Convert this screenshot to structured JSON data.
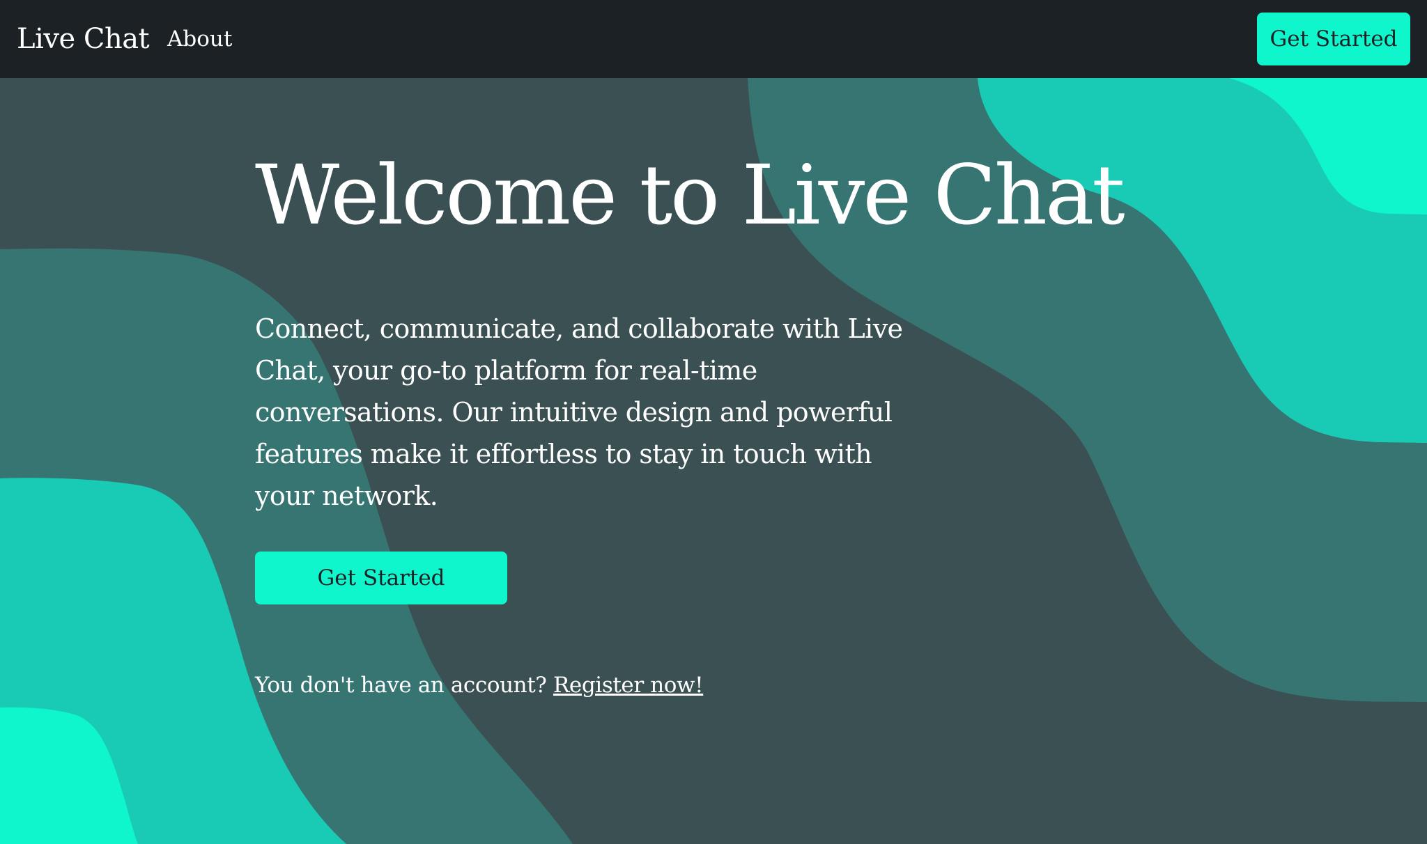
{
  "navbar": {
    "brand": "Live Chat",
    "about_label": "About",
    "cta_label": "Get Started"
  },
  "hero": {
    "title": "Welcome to Live Chat",
    "description": "Connect, communicate, and collaborate with Live Chat, your go-to platform for real-time conversations. Our intuitive design and powerful features make it effortless to stay in touch with your network.",
    "cta_label": "Get Started",
    "register_prompt": "You don't have an account?",
    "register_link": "Register now!"
  },
  "colors": {
    "navbar_bg": "#1b2124",
    "hero_bg": "#3b5052",
    "wave_dark": "#377573",
    "wave_mid": "#19cbb4",
    "wave_bright": "#0ff5cc",
    "button_bg": "#0ff5cc",
    "text": "#ffffff"
  }
}
